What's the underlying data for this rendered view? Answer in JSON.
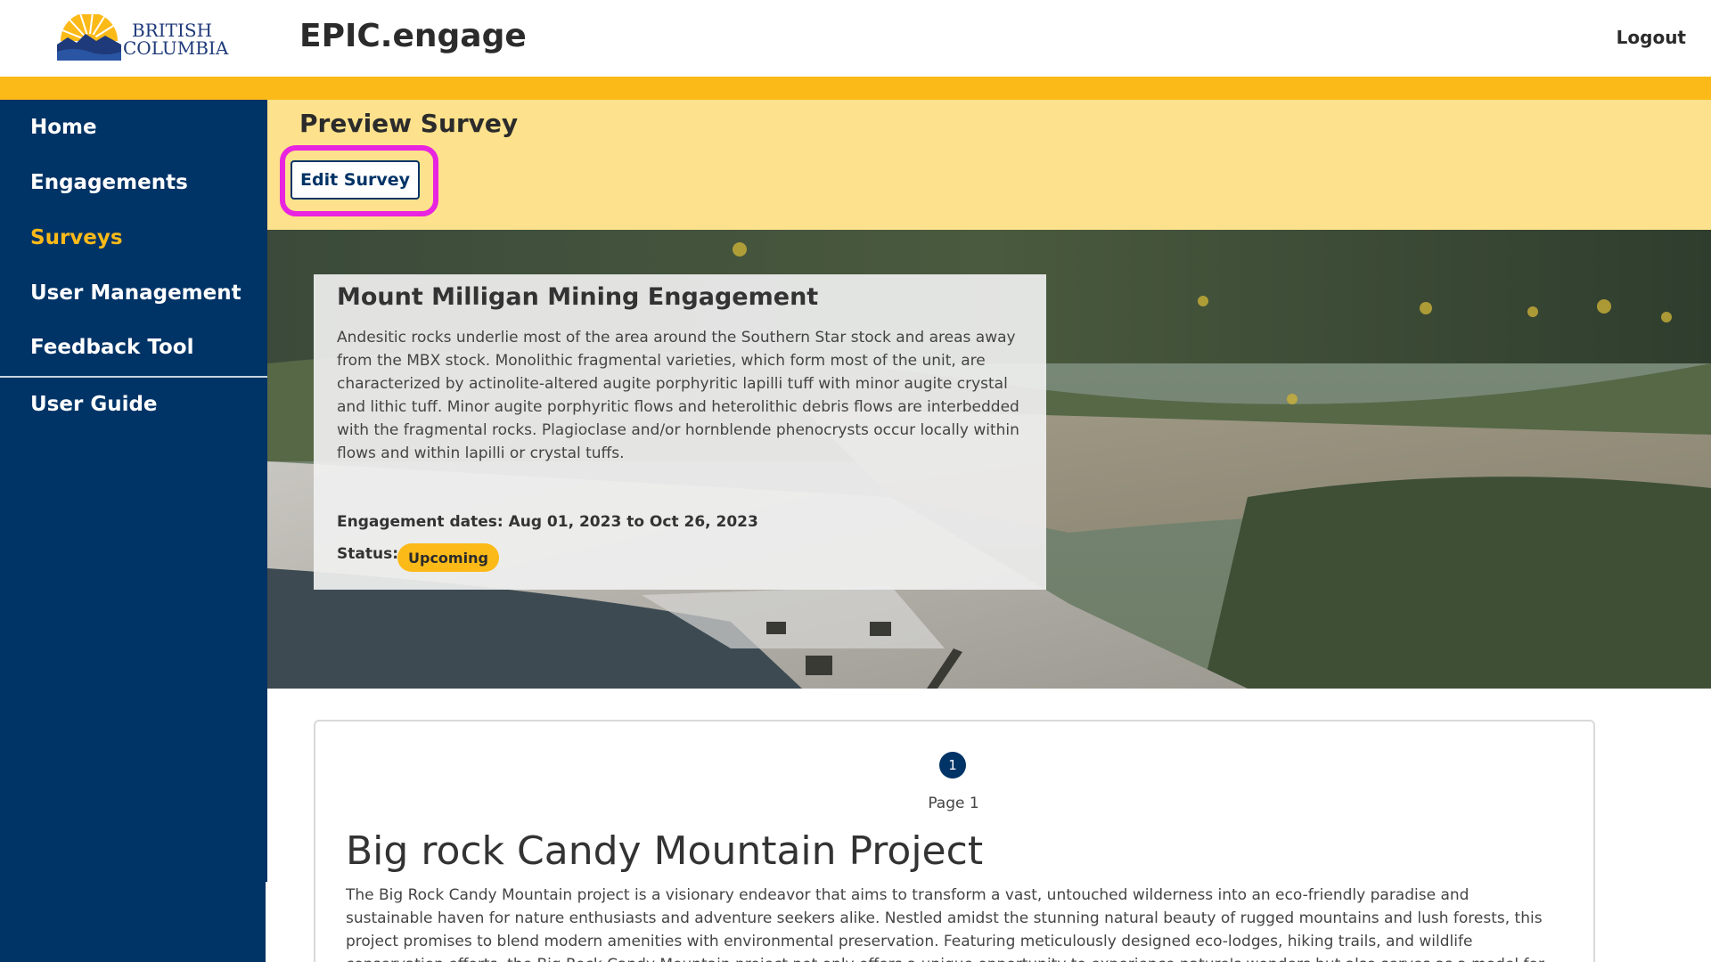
{
  "header": {
    "logo_text": "BRITISH COLUMBIA",
    "app_title": "EPIC.engage",
    "logout_label": "Logout"
  },
  "sidebar": {
    "items": [
      {
        "label": "Home"
      },
      {
        "label": "Engagements"
      },
      {
        "label": "Surveys"
      },
      {
        "label": "User Management"
      },
      {
        "label": "Feedback Tool"
      },
      {
        "label": "User Guide"
      }
    ],
    "active": "Surveys"
  },
  "preview": {
    "title": "Preview Survey",
    "edit_button": "Edit Survey"
  },
  "engagement": {
    "title": "Mount Milligan Mining Engagement",
    "description": "Andesitic rocks underlie most of the area around the Southern Star stock and areas away from the MBX stock. Monolithic fragmental varieties, which form most of the unit, are characterized by actinolite-altered augite porphyritic lapilli tuff with minor augite crystal and lithic tuff. Minor augite porphyritic flows and heterolithic debris flows are interbedded with the fragmental rocks. Plagioclase and/or hornblende phenocrysts occur locally within flows and within lapilli or crystal tuffs.",
    "dates": "Engagement dates: Aug 01, 2023 to Oct 26, 2023",
    "status_label": "Status:",
    "status": "Upcoming"
  },
  "survey": {
    "page_number": "1",
    "page_label": "Page 1",
    "heading": "Big rock Candy Mountain Project",
    "body": "The Big Rock Candy Mountain project is a visionary endeavor that aims to transform a vast, untouched wilderness into an eco-friendly paradise and sustainable haven for nature enthusiasts and adventure seekers alike. Nestled amidst the stunning natural beauty of rugged mountains and lush forests, this project promises to blend modern amenities with environmental preservation. Featuring meticulously designed eco-lodges, hiking trails, and wildlife conservation efforts, the Big Rock Candy Mountain project not only offers a unique opportunity to experience nature's wonders but also serves as a model for responsible and regenerative tourism. Embark on"
  },
  "colors": {
    "navy": "#003366",
    "gold": "#fcba19",
    "preview_band": "#fde18c",
    "highlight": "#e824e0"
  }
}
